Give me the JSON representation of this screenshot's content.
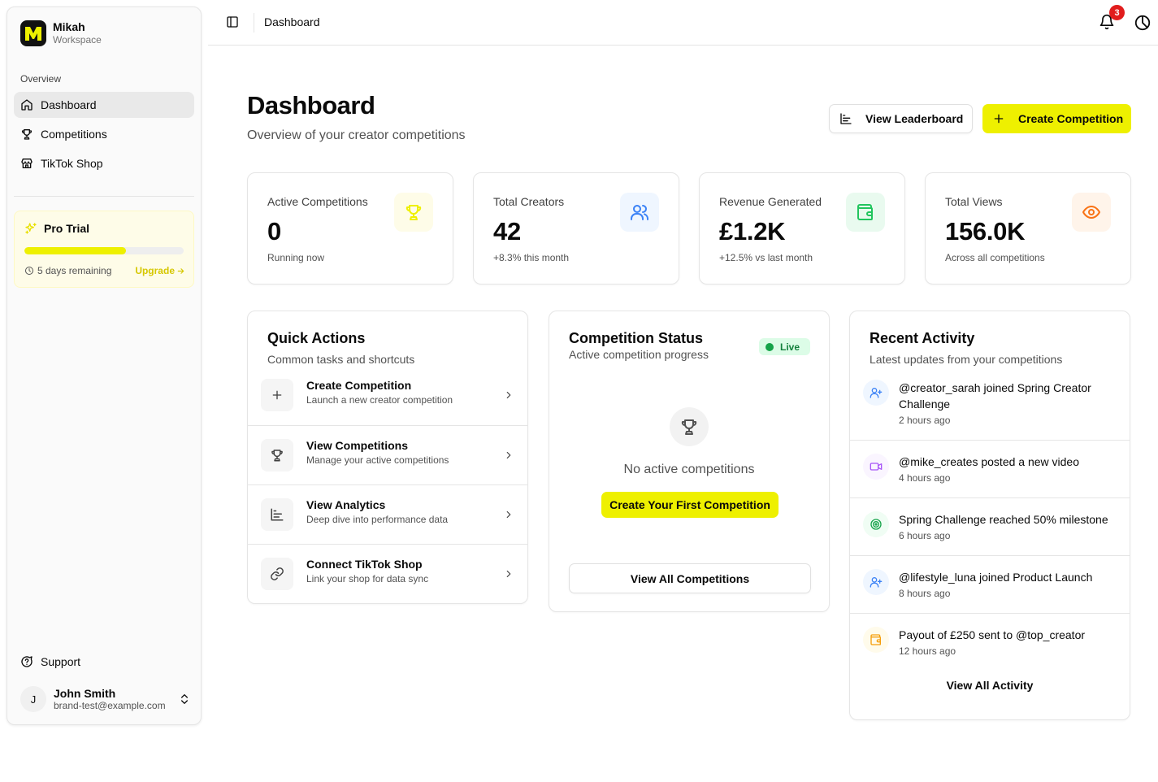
{
  "sidebar": {
    "brand_name": "Mikah",
    "brand_sub": "Workspace",
    "group_label": "Overview",
    "items": [
      {
        "label": "Dashboard",
        "icon": "home-icon"
      },
      {
        "label": "Competitions",
        "icon": "trophy-icon"
      },
      {
        "label": "TikTok Shop",
        "icon": "store-icon"
      }
    ],
    "trial": {
      "title": "Pro Trial",
      "progress": 0.64,
      "remaining": "5 days remaining",
      "upgrade": "Upgrade"
    },
    "support": "Support",
    "user": {
      "initial": "J",
      "name": "John Smith",
      "email": "brand-test@example.com"
    }
  },
  "header": {
    "title": "Dashboard",
    "notification_count": "3"
  },
  "main": {
    "title": "Dashboard",
    "subtitle": "Overview of your creator competitions",
    "view_leaderboard": "View Leaderboard",
    "create_competition": "Create Competition"
  },
  "stats": [
    {
      "label": "Active Competitions",
      "value": "0",
      "note": "Running now",
      "icon": "trophy-icon",
      "color": "#eef000"
    },
    {
      "label": "Total Creators",
      "value": "42",
      "note": "+8.3% this month",
      "icon": "users-icon",
      "color": "#3b82f6"
    },
    {
      "label": "Revenue Generated",
      "value": "£1.2K",
      "note": "+12.5% vs last month",
      "icon": "wallet-icon",
      "color": "#22c55e"
    },
    {
      "label": "Total Views",
      "value": "156.0K",
      "note": "Across all competitions",
      "icon": "eye-icon",
      "color": "#f97316"
    }
  ],
  "quick_actions": {
    "title": "Quick Actions",
    "subtitle": "Common tasks and shortcuts",
    "items": [
      {
        "title": "Create Competition",
        "desc": "Launch a new creator competition",
        "icon": "plus-icon"
      },
      {
        "title": "View Competitions",
        "desc": "Manage your active competitions",
        "icon": "trophy-icon"
      },
      {
        "title": "View Analytics",
        "desc": "Deep dive into performance data",
        "icon": "chart-icon"
      },
      {
        "title": "Connect TikTok Shop",
        "desc": "Link your shop for data sync",
        "icon": "link-icon"
      }
    ]
  },
  "competition_status": {
    "title": "Competition Status",
    "subtitle": "Active competition progress",
    "badge": "Live",
    "empty": "No active competitions",
    "create_first": "Create Your First Competition",
    "view_all": "View All Competitions"
  },
  "recent_activity": {
    "title": "Recent Activity",
    "subtitle": "Latest updates from your competitions",
    "items": [
      {
        "text": "@creator_sarah joined Spring Creator Challenge",
        "time": "2 hours ago",
        "icon": "user-plus-icon",
        "color": "#3b82f6"
      },
      {
        "text": "@mike_creates posted a new video",
        "time": "4 hours ago",
        "icon": "video-icon",
        "color": "#a855f7"
      },
      {
        "text": "Spring Challenge reached 50% milestone",
        "time": "6 hours ago",
        "icon": "target-icon",
        "color": "#16a34a"
      },
      {
        "text": "@lifestyle_luna joined Product Launch",
        "time": "8 hours ago",
        "icon": "user-plus-icon",
        "color": "#3b82f6"
      },
      {
        "text": "Payout of £250 sent to @top_creator",
        "time": "12 hours ago",
        "icon": "wallet-icon",
        "color": "#f59e0b"
      }
    ],
    "view_all": "View All Activity"
  }
}
